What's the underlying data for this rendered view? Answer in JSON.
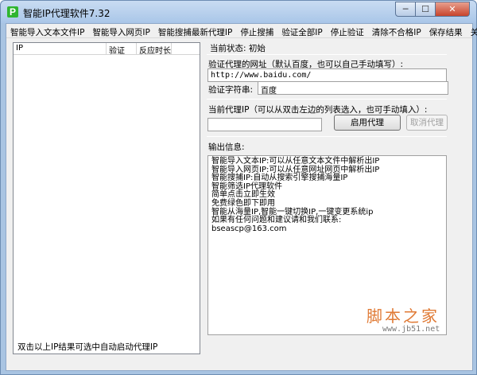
{
  "window": {
    "title": "智能IP代理软件7.32",
    "icon_letter": "P",
    "controls": {
      "minimize": "─",
      "maximize": "☐",
      "close": "✕"
    }
  },
  "menu": [
    "智能导入文本文件IP",
    "智能导入网页IP",
    "智能搜捕最新代理IP",
    "停止搜捕",
    "验证全部IP",
    "停止验证",
    "清除不合格IP",
    "保存结果",
    "关于"
  ],
  "list": {
    "columns": {
      "ip": "IP",
      "verify": "验证",
      "response": "反应时长"
    }
  },
  "hint": "双击以上IP结果可选中自动启动代理IP",
  "status": {
    "text": "当前状态: 初始"
  },
  "verify_url": {
    "label": "验证代理的网址（默认百度，也可以自己手动填写）:",
    "value": "http://www.baidu.com/"
  },
  "verify_string": {
    "label": "验证字符串:",
    "value": "百度"
  },
  "current_proxy": {
    "label": "当前代理IP（可以从双击左边的列表选入，也可手动填入）:",
    "value": "",
    "enable_button": "启用代理",
    "cancel_button": "取消代理"
  },
  "output": {
    "label": "输出信息:",
    "lines": [
      "智能导入文本IP:可以从任意文本文件中解析出IP",
      "智能导入网页IP:可以从任意网址网页中解析出IP",
      "智能搜捕IP:自动从搜索引擎搜捕海量IP",
      "智能筛选IP代理软件",
      "简单点击立即生效",
      "免费绿色即下即用",
      "智能从海量IP,智能一键切换IP,一键变更系统ip",
      "如果有任何问题和建议请和我们联系:",
      "bseascp@163.com"
    ]
  },
  "watermark": {
    "title": "脚本之家",
    "url": "www.jb51.net"
  }
}
